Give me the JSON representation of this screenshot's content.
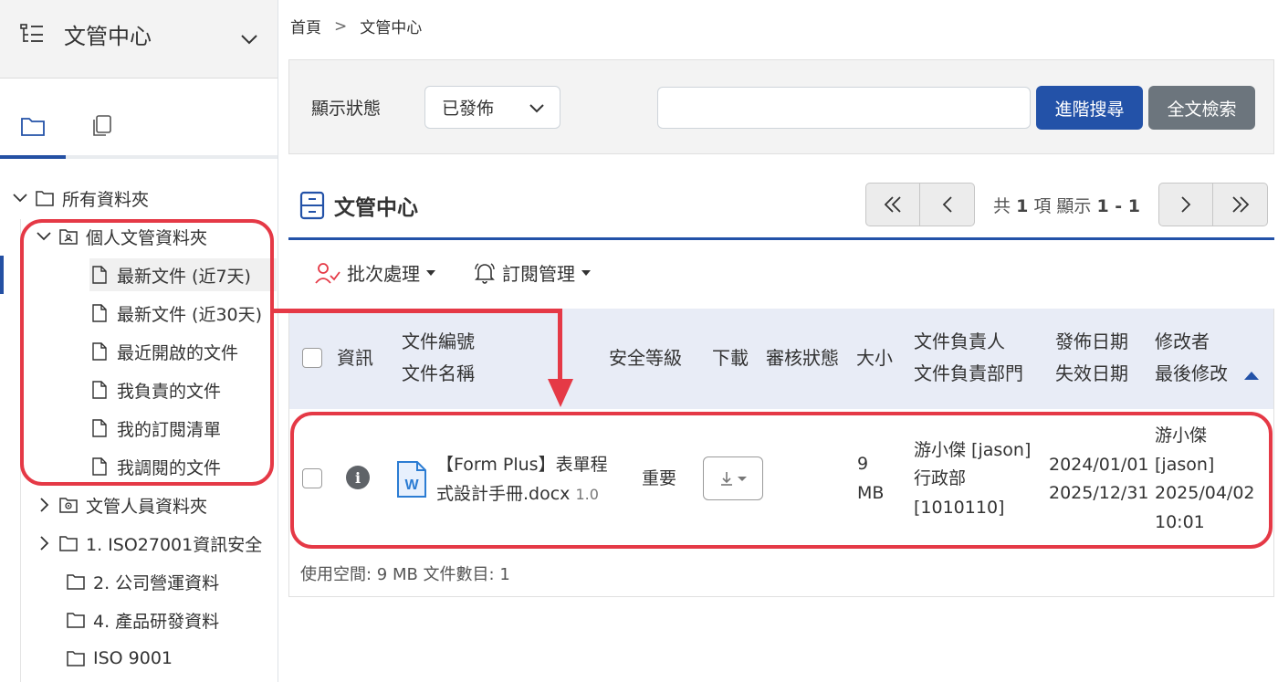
{
  "sidebar": {
    "title": "文管中心",
    "tree": {
      "root": "所有資料夾",
      "personal": "個人文管資料夾",
      "items": [
        "最新文件 (近7天)",
        "最新文件 (近30天)",
        "最近開啟的文件",
        "我負責的文件",
        "我的訂閱清單",
        "我調閱的文件"
      ],
      "staff": "文管人員資料夾",
      "folders": [
        "1. ISO27001資訊安全",
        "2. 公司營運資料",
        "4. 產品研發資料",
        "ISO 9001"
      ]
    }
  },
  "breadcrumb": {
    "home": "首頁",
    "sep": ">",
    "current": "文管中心"
  },
  "filter": {
    "status_label": "顯示狀態",
    "status_value": "已發佈",
    "search_placeholder": "",
    "advanced_search": "進階搜尋",
    "fulltext_search": "全文檢索"
  },
  "section": {
    "title": "文管中心"
  },
  "pager": {
    "prefix": "共",
    "total": "1",
    "mid": "項 顯示",
    "range": "1 - 1"
  },
  "toolbar": {
    "batch": "批次處理",
    "subscribe": "訂閱管理"
  },
  "table": {
    "headers": {
      "info": "資訊",
      "doc_no": "文件編號",
      "doc_name": "文件名稱",
      "security": "安全等級",
      "download": "下載",
      "review": "審核狀態",
      "size": "大小",
      "owner": "文件負責人",
      "dept": "文件負責部門",
      "publish": "發佈日期",
      "expire": "失效日期",
      "modifier": "修改者",
      "last_modified": "最後修改"
    },
    "rows": [
      {
        "name_line1": "【Form Plus】表單程",
        "name_line2": "式設計手冊.docx",
        "version": "1.0",
        "security": "重要",
        "size_line1": "9",
        "size_line2": "MB",
        "owner": "游小傑 [jason]",
        "dept_line1": "行政部",
        "dept_line2": "[1010110]",
        "publish": "2024/01/01",
        "expire": "2025/12/31",
        "modifier_line1": "游小傑",
        "modifier_line2": "[jason]",
        "modified_date": "2025/04/02",
        "modified_time": "10:01"
      }
    ]
  },
  "footer": {
    "summary": "使用空間: 9 MB 文件數目: 1"
  },
  "colors": {
    "primary": "#2352a8",
    "secondary": "#6c757d",
    "annotation": "#e53946",
    "header_bg": "#e8ecf6"
  }
}
